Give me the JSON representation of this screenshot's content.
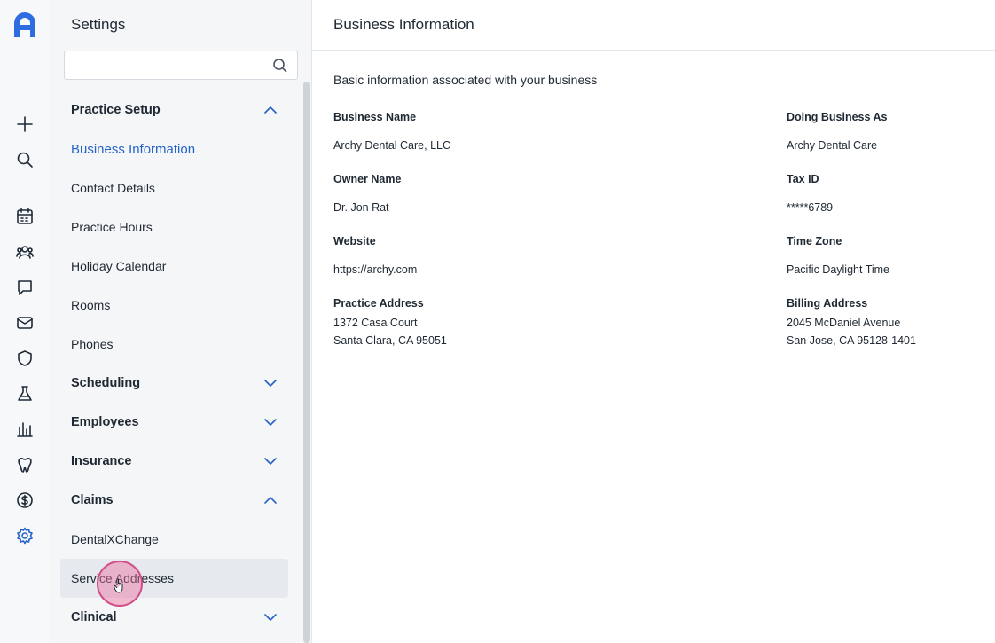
{
  "app": {
    "sidebar_title": "Settings",
    "search": {
      "value": "",
      "placeholder": ""
    }
  },
  "rail": {
    "icons": [
      "archy-logo-icon",
      "plus-icon",
      "search-icon",
      "calendar-icon",
      "patients-icon",
      "chat-icon",
      "mail-icon",
      "shield-icon",
      "flask-icon",
      "chart-icon",
      "tooth-icon",
      "dollar-icon",
      "gear-icon"
    ],
    "active_color": "#2563c9"
  },
  "nav": {
    "items": [
      {
        "label": "Practice Setup",
        "type": "section",
        "expanded": true
      },
      {
        "label": "Business Information",
        "type": "item",
        "active": true
      },
      {
        "label": "Contact Details",
        "type": "item"
      },
      {
        "label": "Practice Hours",
        "type": "item"
      },
      {
        "label": "Holiday Calendar",
        "type": "item"
      },
      {
        "label": "Rooms",
        "type": "item"
      },
      {
        "label": "Phones",
        "type": "item"
      },
      {
        "label": "Scheduling",
        "type": "section",
        "expanded": false
      },
      {
        "label": "Employees",
        "type": "section",
        "expanded": false
      },
      {
        "label": "Insurance",
        "type": "section",
        "expanded": false
      },
      {
        "label": "Claims",
        "type": "section",
        "expanded": true
      },
      {
        "label": "DentalXChange",
        "type": "item"
      },
      {
        "label": "Service Addresses",
        "type": "item",
        "hover": true
      },
      {
        "label": "Clinical",
        "type": "section",
        "expanded": false
      }
    ]
  },
  "main": {
    "title": "Business Information",
    "intro": "Basic information associated with your business",
    "fields": {
      "business_name": {
        "label": "Business Name",
        "value": "Archy Dental Care, LLC"
      },
      "dba": {
        "label": "Doing Business As",
        "value": "Archy Dental Care"
      },
      "owner": {
        "label": "Owner Name",
        "value": "Dr. Jon Rat"
      },
      "tax_id": {
        "label": "Tax ID",
        "value": "*****6789"
      },
      "website": {
        "label": "Website",
        "value": "https://archy.com"
      },
      "timezone": {
        "label": "Time Zone",
        "value": "Pacific Daylight Time"
      },
      "practice_address": {
        "label": "Practice Address",
        "line1": "1372 Casa Court",
        "line2": "Santa Clara, CA 95051"
      },
      "billing_address": {
        "label": "Billing Address",
        "line1": "2045 McDaniel Avenue",
        "line2": "San Jose, CA 95128-1401"
      }
    }
  },
  "colors": {
    "accent": "#2563c9",
    "cursor": "#d14b86"
  }
}
